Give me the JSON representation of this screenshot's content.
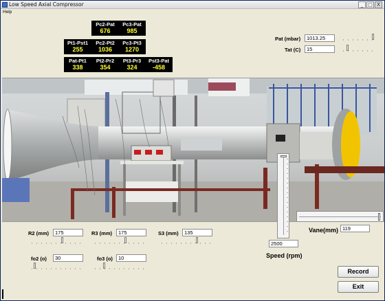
{
  "window": {
    "title": "Low Speed Axial Compressor",
    "controls": {
      "minimize": "_",
      "maximize": "□",
      "close": "X"
    }
  },
  "menu": {
    "items": [
      "Help"
    ]
  },
  "sensors": [
    {
      "label": "Pc2-Pat",
      "value": "676"
    },
    {
      "label": "Pc3-Pat",
      "value": "985"
    },
    {
      "label": "Pt1-Pst1",
      "value": "255"
    },
    {
      "label": "Pc2-Pt2",
      "value": "1036"
    },
    {
      "label": "Pc3-Pt3",
      "value": "1270"
    },
    {
      "label": "Pat-Pt1",
      "value": "338"
    },
    {
      "label": "Pt2-Pr2",
      "value": "354"
    },
    {
      "label": "Pt3-Pr3",
      "value": "324"
    },
    {
      "label": "Pst3-Pat",
      "value": "-458"
    }
  ],
  "ambient": {
    "pat_label": "Pat (mbar)",
    "pat_value": "1013.25",
    "tat_label": "Tat (C)",
    "tat_value": "15"
  },
  "params": {
    "r2_label": "R2 (mm)",
    "r2_value": "175",
    "r3_label": "R3 (mm)",
    "r3_value": "175",
    "s3_label": "S3 (mm)",
    "s3_value": "135",
    "fo2_label": "fo2 (o)",
    "fo2_value": "30",
    "fo3_label": "fo3 (o)",
    "fo3_value": "10"
  },
  "speed": {
    "label": "Speed (rpm)",
    "value": "2500"
  },
  "vane": {
    "label": "Vane(mm)",
    "value": "119"
  },
  "buttons": {
    "record": "Record",
    "exit": "Exit"
  },
  "photo": {
    "subject": "low speed axial compressor test rig"
  },
  "colors": {
    "sensor_bg": "#000000",
    "sensor_label": "#ffffff",
    "sensor_value": "#ffff33",
    "window_bg": "#ece9d8",
    "rotor_yellow": "#f2c400"
  },
  "slider_levels": {
    "pat": 0.95,
    "tat": 0.2,
    "r2": 0.62,
    "r3": 0.62,
    "s3": 0.72,
    "fo2": 0.1,
    "fo3": 0.22,
    "speed": 0.0,
    "vane": 0.98
  }
}
